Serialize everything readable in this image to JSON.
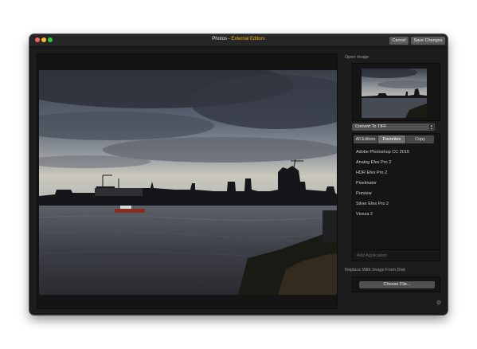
{
  "window": {
    "title_app": "Photos",
    "title_separator": " - ",
    "title_panel": "External Editors",
    "cancel_label": "Cancel",
    "save_label": "Save Changes"
  },
  "sidebar": {
    "open_image_label": "Open Image",
    "format_select_value": "Convert To TIFF",
    "tabs": [
      {
        "label": "All Editors",
        "active": false
      },
      {
        "label": "Favorites",
        "active": true
      },
      {
        "label": "Copy",
        "active": false
      }
    ],
    "editors": [
      "Adobe Photoshop CC 2015",
      "Analog Efex Pro 2",
      "HDR Efex Pro 2",
      "Pixelmator",
      "Preview",
      "Silver Efex Pro 2",
      "Viveza 2"
    ],
    "add_application_label": "Add Application",
    "replace_label": "Replace With Image From Disk",
    "choose_file_label": "Choose File..."
  },
  "icons": {
    "close": "close-icon",
    "minimize": "minimize-icon",
    "maximize": "maximize-icon",
    "select_arrows": "up-down-chevron-icon",
    "settings": "gear-icon"
  },
  "colors": {
    "accent": "#f5b21a",
    "window_bg": "#1c1c1c",
    "button_bg": "#505050"
  }
}
